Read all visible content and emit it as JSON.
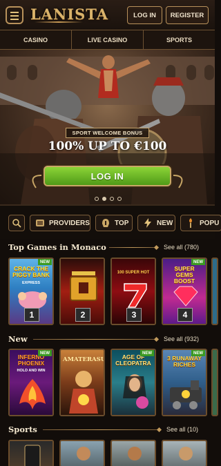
{
  "header": {
    "logo": "LANISTA",
    "login_label": "LOG IN",
    "register_label": "REGISTER"
  },
  "nav": {
    "tabs": [
      "CASINO",
      "LIVE CASINO",
      "SPORTS"
    ]
  },
  "hero": {
    "bonus_label": "SPORT WELCOME BONUS",
    "bonus_amount": "100% UP TO €100",
    "login_label": "LOG IN",
    "slide_count": 4,
    "active_slide": 2
  },
  "filters": {
    "providers": "PROVIDERS",
    "top": "TOP",
    "new": "NEW",
    "popular": "POPU"
  },
  "top_games": {
    "title": "Top Games in Monaco",
    "see_all": "See all (780)",
    "games": [
      {
        "name": "CRACK THE PIGGY BANK",
        "sub": "EXPRESS",
        "rank": "1",
        "badge": "NEW"
      },
      {
        "name": "",
        "sub": "",
        "rank": "2",
        "badge": ""
      },
      {
        "name": "100 SUPER HOT",
        "sub": "",
        "rank": "3",
        "badge": ""
      },
      {
        "name": "SUPER GEMS BOOST",
        "sub": "",
        "rank": "4",
        "badge": "NEW"
      }
    ]
  },
  "new_games": {
    "title": "New",
    "see_all": "See all (932)",
    "games": [
      {
        "name": "INFERNO PHOENIX",
        "sub": "HOLD AND WIN",
        "badge": "NEW"
      },
      {
        "name": "AMATERASU",
        "sub": "",
        "badge": ""
      },
      {
        "name": "AGE OF CLEOPATRA",
        "sub": "",
        "badge": "NEW"
      },
      {
        "name": "3 RUNAWAY RICHES",
        "sub": "",
        "badge": "NEW"
      }
    ]
  },
  "sports": {
    "title": "Sports",
    "see_all": "See all (10)"
  },
  "colors": {
    "gold": "#c9a766",
    "green_button": "#6cb62a",
    "background": "#120d0a"
  }
}
